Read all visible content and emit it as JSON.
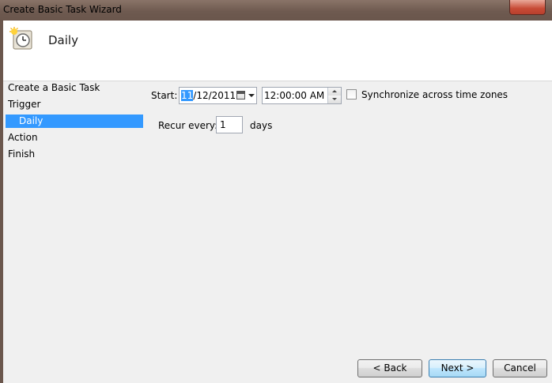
{
  "window": {
    "title": "Create Basic Task Wizard"
  },
  "header": {
    "title": "Daily",
    "icon": "task-clock-icon"
  },
  "sidenav": {
    "items": [
      {
        "label": "Create a Basic Task"
      },
      {
        "label": "Trigger"
      },
      {
        "label": "Daily",
        "selected": true
      },
      {
        "label": "Action"
      },
      {
        "label": "Finish"
      }
    ]
  },
  "form": {
    "start_label": "Start:",
    "date_selected_part": "11",
    "date_rest": "/12/2011",
    "time_value": "12:00:00 AM",
    "sync_label": "Synchronize across time zones",
    "sync_checked": false,
    "recur_label": "Recur every:",
    "recur_value": "1",
    "recur_unit": "days"
  },
  "buttons": {
    "back": "< Back",
    "next": "Next >",
    "cancel": "Cancel"
  },
  "colors": {
    "selection": "#3399ff",
    "title_bar": "#6e5a50",
    "close_button": "#c74b36"
  }
}
